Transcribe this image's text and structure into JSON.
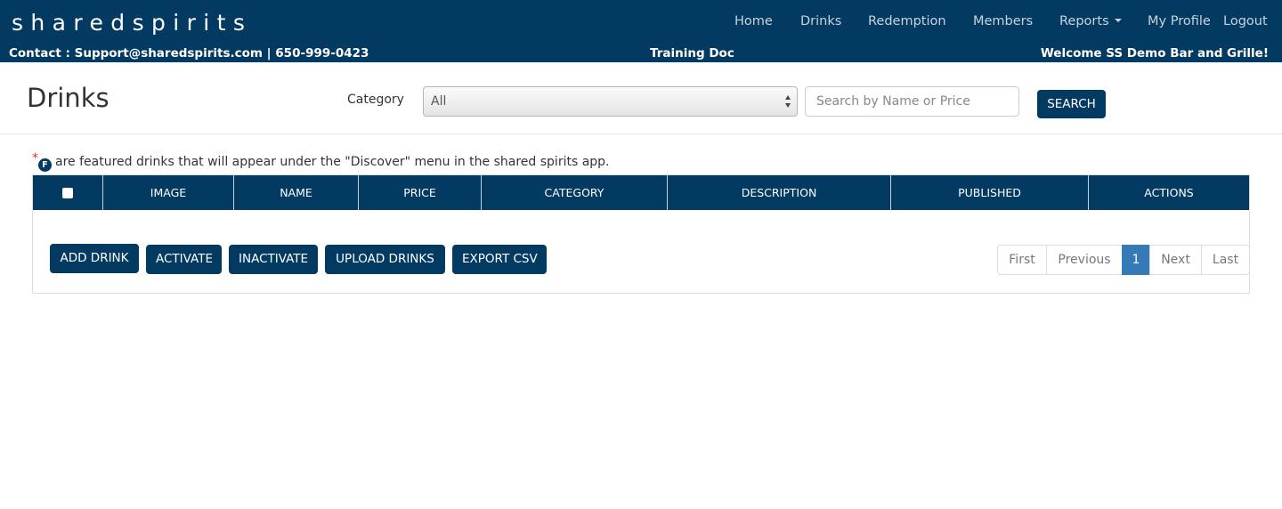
{
  "header": {
    "logo": "sharedspirits",
    "nav": [
      {
        "label": "Home"
      },
      {
        "label": "Drinks"
      },
      {
        "label": "Redemption"
      },
      {
        "label": "Members"
      },
      {
        "label": "Reports"
      },
      {
        "label": "My Profile"
      },
      {
        "label": "Logout"
      }
    ],
    "contact": "Contact : Support@sharedspirits.com | 650-999-0423",
    "training_doc": "Training Doc",
    "welcome": "Welcome SS Demo Bar and Grille!"
  },
  "toolbar": {
    "title": "Drinks",
    "category_label": "Category",
    "category_value": "All",
    "search_placeholder": "Search by Name or Price",
    "search_button": "SEARCH"
  },
  "note": {
    "star": "*",
    "badge": "F",
    "text": "are featured drinks that will appear under the \"Discover\" menu in the shared spirits app."
  },
  "table": {
    "columns": [
      "IMAGE",
      "NAME",
      "PRICE",
      "CATEGORY",
      "DESCRIPTION",
      "PUBLISHED",
      "ACTIONS"
    ]
  },
  "actions": {
    "add_drink": "ADD DRINK",
    "activate": "ACTIVATE",
    "inactivate": "INACTIVATE",
    "upload_drinks": "UPLOAD DRINKS",
    "export_csv": "EXPORT CSV"
  },
  "pagination": {
    "first": "First",
    "previous": "Previous",
    "current": "1",
    "next": "Next",
    "last": "Last"
  },
  "colors": {
    "brand": "#033a61",
    "active_page": "#337ab7",
    "required_star": "#d9302c"
  }
}
